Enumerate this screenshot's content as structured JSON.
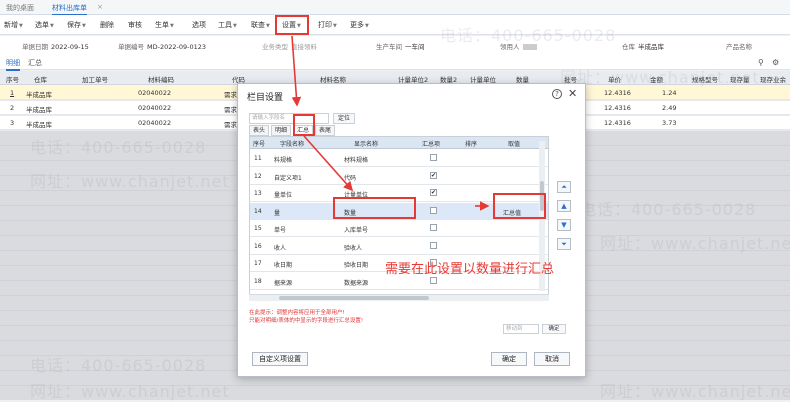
{
  "tabs": [
    "我的桌面",
    "材料出库单"
  ],
  "toolbar": {
    "items": [
      "新增",
      "选单",
      "保存",
      "删除",
      "审核",
      "生单",
      "选项",
      "工具",
      "联查",
      "设置",
      "打印",
      "更多"
    ]
  },
  "header": {
    "date_label": "单据日期",
    "date": "2022-09-15",
    "code_label": "单据编号",
    "code": "MD-2022-09-0123",
    "type_label": "业务类型",
    "type": "直接领料",
    "dept_label": "生产车间",
    "dept": "一车间",
    "picker_label": "领用人",
    "warehouse_label": "仓库",
    "warehouse": "半成品库",
    "product_label": "产品名称"
  },
  "subtabs": [
    "明细",
    "汇总"
  ],
  "grid": {
    "headers": [
      "序号",
      "仓库",
      "加工单号",
      "材料编码",
      "代码",
      "材料名称",
      "计量单位2",
      "数量2",
      "计量单位",
      "数量",
      "批号",
      "单价",
      "金额",
      "规格型号",
      "现存量",
      "现存业余"
    ],
    "rows": [
      {
        "no": "1",
        "wh": "半成品库",
        "code": "02040022",
        "name": "需求部 之群",
        "price": "12.4316",
        "amount": "1.24"
      },
      {
        "no": "2",
        "wh": "半成品库",
        "code": "02040022",
        "name": "需求部 之群",
        "price": "12.4316",
        "amount": "2.49"
      },
      {
        "no": "3",
        "wh": "半成品库",
        "code": "02040022",
        "name": "需求部 之群",
        "price": "12.4316",
        "amount": "3.73"
      }
    ]
  },
  "watermark": {
    "phone": "电话：400-665-0028",
    "site": "网址：www.chanjet.net"
  },
  "dialog": {
    "title": "栏目设置",
    "search_placeholder": "请输入字段名",
    "locate": "定位",
    "tabs": [
      "表头",
      "明细",
      "汇总",
      "表尾"
    ],
    "columns": [
      "序号",
      "字段名称",
      "显示名称",
      "汇总项",
      "排序",
      "取值"
    ],
    "rows": [
      {
        "no": "11",
        "field": "料规格",
        "display": "材料规格",
        "sum": false
      },
      {
        "no": "12",
        "field": "自定义项1",
        "display": "代码",
        "sum": true
      },
      {
        "no": "13",
        "field": "量单位",
        "display": "计量单位",
        "sum": true
      },
      {
        "no": "14",
        "field": "量",
        "display": "数量",
        "sum": false,
        "value": "汇总值"
      },
      {
        "no": "15",
        "field": "单号",
        "display": "入库单号",
        "sum": false
      },
      {
        "no": "16",
        "field": "收人",
        "display": "验收人",
        "sum": false
      },
      {
        "no": "17",
        "field": "收日期",
        "display": "验收日期",
        "sum": false
      },
      {
        "no": "18",
        "field": "据来源",
        "display": "数据来源",
        "sum": false
      },
      {
        "no": "19",
        "field": "量单位组合",
        "display": "计量单位组合",
        "sum": false
      }
    ],
    "tip_line1": "在此提示：调整内容将应用于全部用户!",
    "tip_line2": "只能对明细/表体的中显示的字段进行汇总设置!",
    "move_placeholder": "移动到",
    "move_ok": "确定",
    "custom_button": "自定义项设置",
    "ok_button": "确定",
    "cancel_button": "取消"
  },
  "annotation": "需要在此设置以数量进行汇总",
  "colors": {
    "accent": "#2a6fc9",
    "highlight": "#e53935"
  }
}
